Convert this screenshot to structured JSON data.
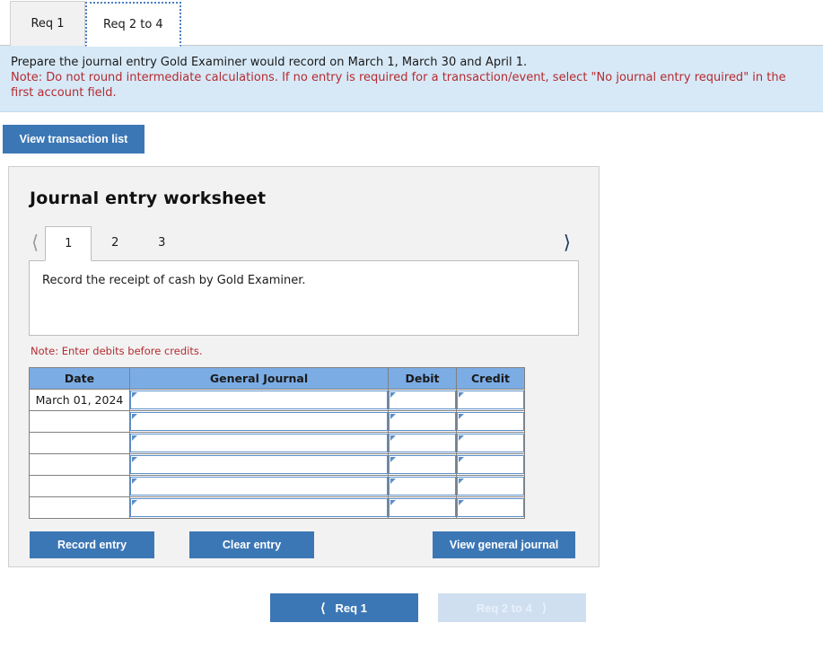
{
  "tabs": [
    {
      "label": "Req 1",
      "active": false
    },
    {
      "label": "Req 2 to 4",
      "active": true
    }
  ],
  "banner": {
    "line1": "Prepare the journal entry Gold Examiner would record on March 1, March 30 and April 1.",
    "note": "Note: Do not round intermediate calculations. If no entry is required for a transaction/event, select \"No journal entry required\" in the first account field.",
    "background_color": "#D7E9F7",
    "note_color": "#B42B30"
  },
  "toolbar": {
    "view_transaction_list_label": "View transaction list"
  },
  "worksheet": {
    "title": "Journal entry worksheet",
    "pager": {
      "prev_icon": "chevron-left-icon",
      "next_icon": "chevron-right-icon",
      "pages": [
        "1",
        "2",
        "3"
      ],
      "active_page": "1"
    },
    "description": "Record the receipt of cash by Gold Examiner.",
    "note": "Note: Enter debits before credits.",
    "table": {
      "headers": [
        "Date",
        "General Journal",
        "Debit",
        "Credit"
      ],
      "rows": [
        {
          "date": "March 01, 2024",
          "general_journal": "",
          "debit": "",
          "credit": ""
        },
        {
          "date": "",
          "general_journal": "",
          "debit": "",
          "credit": ""
        },
        {
          "date": "",
          "general_journal": "",
          "debit": "",
          "credit": ""
        },
        {
          "date": "",
          "general_journal": "",
          "debit": "",
          "credit": ""
        },
        {
          "date": "",
          "general_journal": "",
          "debit": "",
          "credit": ""
        },
        {
          "date": "",
          "general_journal": "",
          "debit": "",
          "credit": ""
        }
      ],
      "header_color": "#7BACE4"
    },
    "actions": {
      "record_entry_label": "Record entry",
      "clear_entry_label": "Clear entry",
      "view_general_journal_label": "View general journal"
    },
    "panel_background": "#F2F2F2"
  },
  "bottom_nav": {
    "prev": {
      "label": "Req 1",
      "icon": "chevron-left-icon",
      "enabled": true
    },
    "next": {
      "label": "Req 2 to 4",
      "icon": "chevron-right-icon",
      "enabled": false
    },
    "active_color": "#3C77B5",
    "disabled_color": "#CFDFF0"
  }
}
